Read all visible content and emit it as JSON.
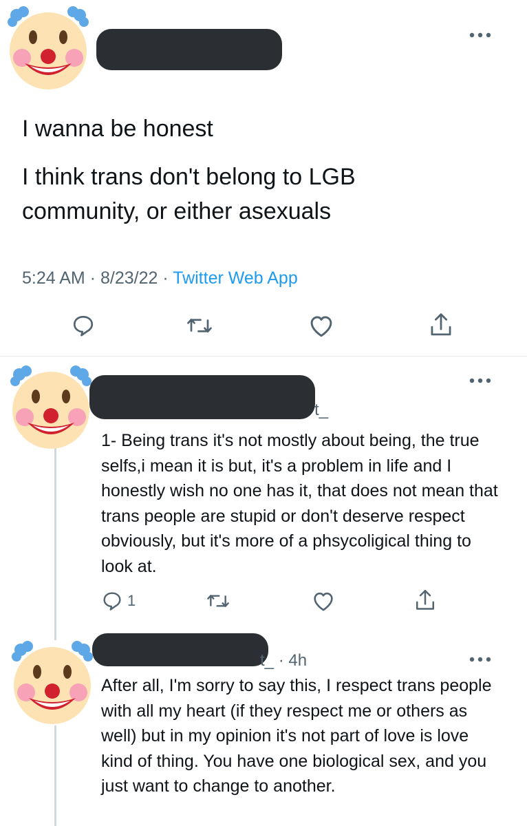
{
  "main_tweet": {
    "avatar_icon": "clown-face-icon",
    "more_icon": "more-horizontal-icon",
    "text_line1": "I wanna be honest",
    "text_body": "I think trans don't belong to LGB\ncommunity, or either asexuals",
    "time": "5:24 AM",
    "sep1": "·",
    "date": "8/23/22",
    "sep2": "·",
    "source": "Twitter Web App",
    "actions": {
      "reply_icon": "reply-icon",
      "retweet_icon": "retweet-icon",
      "like_icon": "heart-icon",
      "share_icon": "share-icon"
    }
  },
  "reply1": {
    "avatar_icon": "clown-face-icon",
    "handle_fragment": "t_",
    "more_icon": "more-horizontal-icon",
    "text": "1- Being trans it's not mostly about being, the true selfs,i mean it is but, it's a problem in life and I honestly wish no one has it, that does not mean that trans people are stupid or don't deserve respect obviously, but it's more of a phsycoligical thing to look at.",
    "reply_count": "1",
    "actions": {
      "reply_icon": "reply-icon",
      "retweet_icon": "retweet-icon",
      "like_icon": "heart-icon",
      "share_icon": "share-icon"
    }
  },
  "reply2": {
    "avatar_icon": "clown-face-icon",
    "handle_fragment": "t_",
    "sep": "·",
    "time": "4h",
    "more_icon": "more-horizontal-icon",
    "text": "After all, I'm sorry to say this, I respect trans people with all my heart (if they respect me or others as well) but in my opinion it's not part of love is love kind of thing. You have one biological sex, and you just want to change to another."
  },
  "colors": {
    "text": "#0f1419",
    "secondary": "#536471",
    "link": "#1d9bf0",
    "redaction": "#2b2f33",
    "clown_face": "#fde2b4",
    "clown_nose": "#d1202e",
    "clown_hair": "#5ea8e8",
    "clown_cheeks": "#f7a2b6"
  }
}
